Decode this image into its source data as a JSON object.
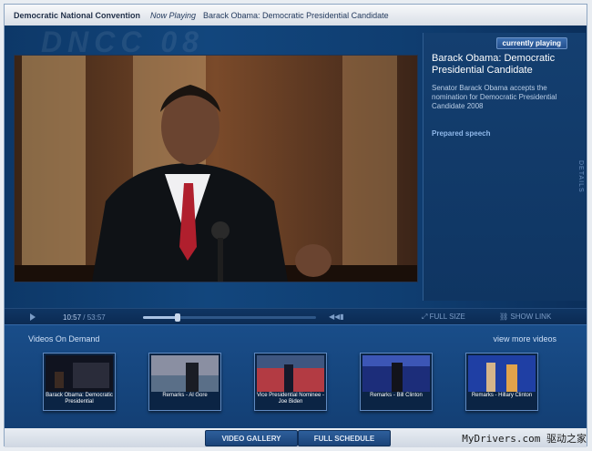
{
  "topbar": {
    "site": "Democratic National Convention",
    "now_playing_label": "Now Playing",
    "now_playing_title": "Barack Obama: Democratic Presidential Candidate"
  },
  "stage": {
    "watermark": "DNCC 08"
  },
  "panel": {
    "badge": "currently playing",
    "title": "Barack Obama: Democratic Presidential Candidate",
    "description": "Senator Barack Obama accepts the nomination for Democratic Presidential Candidate 2008",
    "type": "Prepared speech",
    "details": "DETAILS"
  },
  "controls": {
    "current_time": "10:57",
    "separator": " / ",
    "total_time": "53:57",
    "progress": 0.2,
    "full_size": "FULL SIZE",
    "show_link": "SHOW LINK"
  },
  "vod": {
    "title": "Videos On Demand",
    "more": "view more videos",
    "items": [
      {
        "label": "Barack Obama: Democratic Presidential"
      },
      {
        "label": "Remarks - Al Gore"
      },
      {
        "label": "Vice Presidential Nominee - Joe Biden"
      },
      {
        "label": "Remarks - Bill Clinton"
      },
      {
        "label": "Remarks - Hillary Clinton"
      }
    ]
  },
  "bottom": {
    "video_gallery": "VIDEO GALLERY",
    "full_schedule": "FULL SCHEDULE"
  },
  "watermark": "MyDrivers.com 驱动之家"
}
